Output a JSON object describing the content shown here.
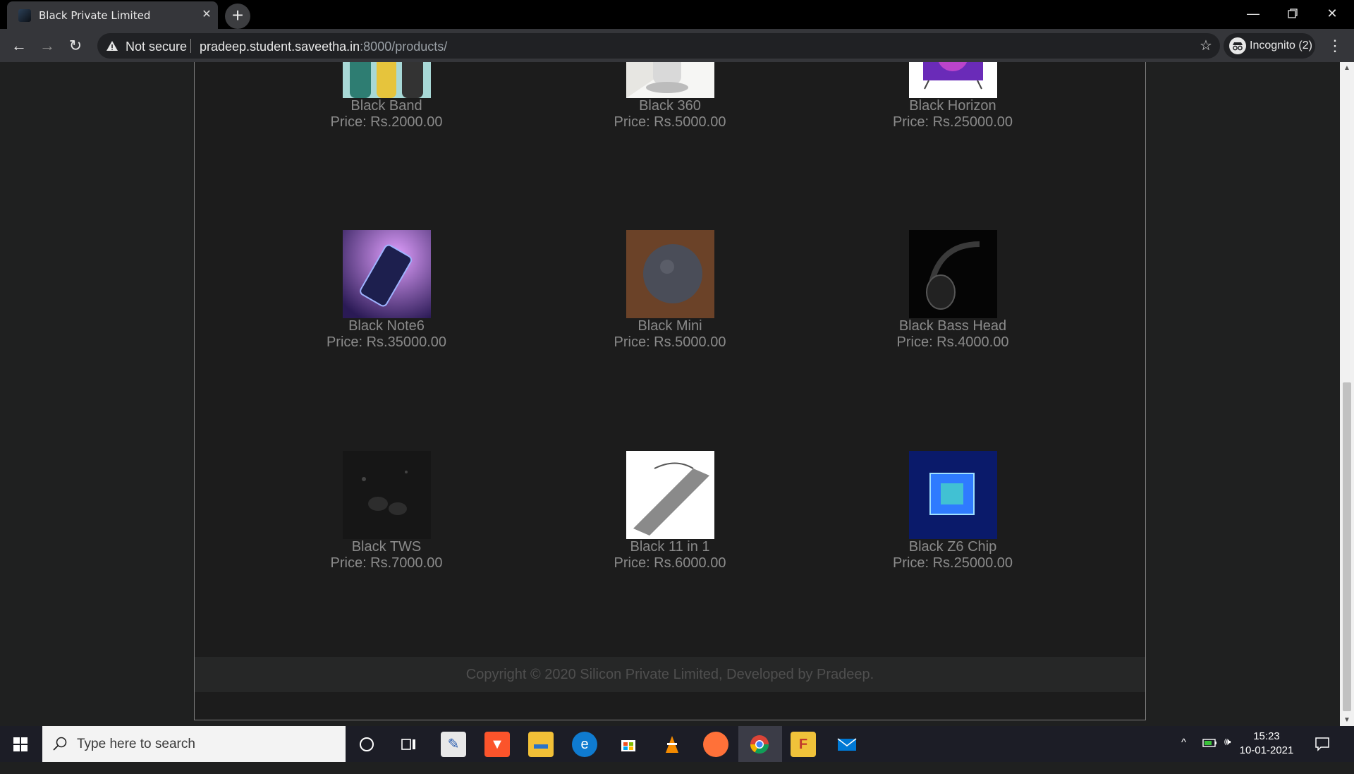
{
  "browser": {
    "tab_title": "Black Private Limited",
    "not_secure": "Not secure",
    "url_host": "pradeep.student.saveetha.in",
    "url_path": ":8000/products/",
    "incognito_label": "Incognito (2)"
  },
  "products": [
    {
      "name": "Black Band",
      "price": "Price: Rs.2000.00"
    },
    {
      "name": "Black 360",
      "price": "Price: Rs.5000.00"
    },
    {
      "name": "Black Horizon",
      "price": "Price: Rs.25000.00"
    },
    {
      "name": "Black Note6",
      "price": "Price: Rs.35000.00"
    },
    {
      "name": "Black Mini",
      "price": "Price: Rs.5000.00"
    },
    {
      "name": "Black Bass Head",
      "price": "Price: Rs.4000.00"
    },
    {
      "name": "Black TWS",
      "price": "Price: Rs.7000.00"
    },
    {
      "name": "Black 11 in 1",
      "price": "Price: Rs.6000.00"
    },
    {
      "name": "Black Z6 Chip",
      "price": "Price: Rs.25000.00"
    }
  ],
  "footer": {
    "text": "Copyright © 2020 Silicon Private Limited, Developed by Pradeep."
  },
  "taskbar": {
    "search_placeholder": "Type here to search",
    "time": "15:23",
    "date": "10-01-2021"
  },
  "colors": {
    "page_bg": "#1f2020",
    "text_muted": "#8a8a8a",
    "chrome_dark": "#35363a"
  }
}
